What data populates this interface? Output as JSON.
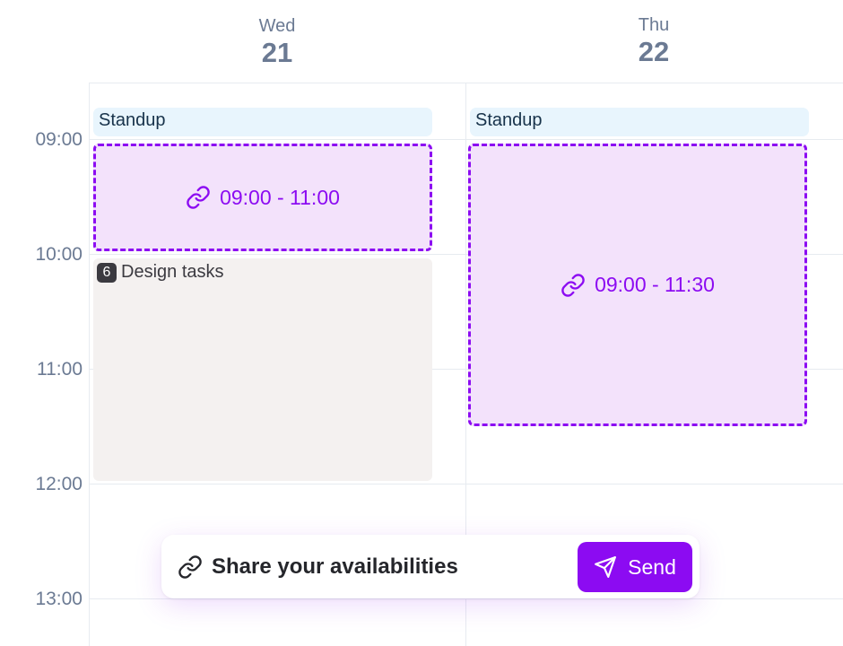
{
  "days": [
    {
      "name": "Wed",
      "date": "21"
    },
    {
      "name": "Thu",
      "date": "22"
    }
  ],
  "time_labels": [
    "09:00",
    "10:00",
    "11:00",
    "12:00",
    "13:00"
  ],
  "events": {
    "wed_standup": "Standup",
    "thu_standup": "Standup",
    "wed_slot": "09:00 - 11:00",
    "thu_slot": "09:00 - 11:30",
    "design_badge": "6",
    "design_title": "Design tasks"
  },
  "share_bar": {
    "label": "Share your availabilities",
    "send_label": "Send"
  },
  "colors": {
    "accent": "#8c0bf2",
    "slot_fill": "#f3e2fb",
    "standup_fill": "#e8f5fd",
    "design_fill": "#f4f1f0",
    "muted_text": "#6b7a93"
  },
  "icons": {
    "slot": "link-icon",
    "share": "link-icon",
    "send": "send-icon"
  }
}
